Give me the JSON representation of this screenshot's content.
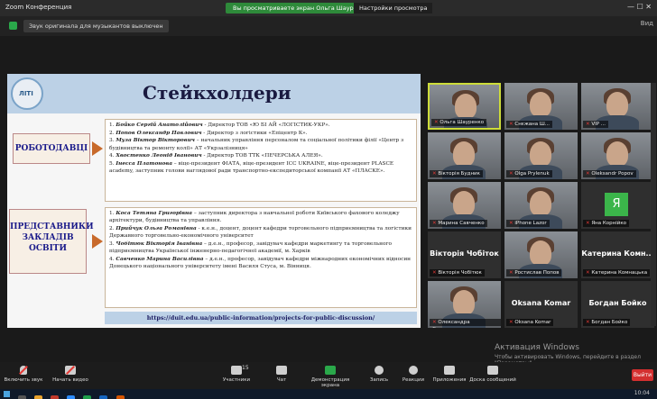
{
  "titlebar": {
    "app_title": "Zoom Конференция",
    "share_notice": "Вы просматриваете экран Ольга Шауренко",
    "view_options": "Настройки просмотра",
    "controls": "— ☐ ✕"
  },
  "notice": {
    "text": "Звук оригинала для музыкантов выключен",
    "right_label": "Вид"
  },
  "slide": {
    "logo_text": "ЛІТІ",
    "title": "Стейкхолдери",
    "label_employers": "РОБОТОДАВЦІ",
    "label_edu_lines": [
      "ПРЕДСТАВНИКИ",
      "ЗАКЛАДІВ",
      "ОСВІТИ"
    ],
    "employers": [
      {
        "n": "1.",
        "name": "Бойко Сергій Анатолійович",
        "text": " - Директор ТОВ «Ю БІ АЙ «ЛОГІСТИК-УКР»."
      },
      {
        "n": "2.",
        "name": "Попов Олександр Павлович",
        "text": " - Директор з логістики «Епіцентр К»."
      },
      {
        "n": "3.",
        "name": "Муза Віктор Вікторович",
        "text": " – начальник управління персоналом та соціальної політики філії «Центр з будівництва та ремонту колії» АТ «Укрзалізниця»"
      },
      {
        "n": "4.",
        "name": "Хвостенко Леонід Іванович",
        "text": " - Директор ТОВ ТТК «ПЕЧЕРСЬКА АЛЕЯ»."
      },
      {
        "n": "5.",
        "name": "Інесса Платонова",
        "text": " – віце-президент ФІАТА, віце-президент ICC UKRAINE, віце-президент PLASCE academy, заступник голови наглядової ради транспортно-експедиторської компанії АТ «ПЛАСКЕ»."
      }
    ],
    "edu": [
      {
        "n": "1.",
        "name": "Коса Тетяна Григорівна",
        "text": " – заступник директора з навчальної роботи Київського фахового коледжу архітектури, будівництва та управління."
      },
      {
        "n": "2.",
        "name": "Прийчук Ольга Романівна",
        "text": " - к.е.н., доцент, доцент кафедри торговельного підприємництва та логістики Державного торговельно-економічного університет"
      },
      {
        "n": "3.",
        "name": "Чобітюк Вікторія Іванівна",
        "text": " – д.е.н., професор, завідувач кафедри маркетингу та торговельного підприємництва Української інженерно-педагогічної академії, м. Харків"
      },
      {
        "n": "4.",
        "name": "Савченко Марина Василівна",
        "text": " – д.е.н., професор, завідувач кафедри міжнародних економічних відносин Донецького національного університету імені Василя Стуса, м. Вінниця."
      }
    ],
    "url": "https://duit.edu.ua/public-information/projects-for-public-discussion/"
  },
  "participants": [
    {
      "name": "Ольга Шауренко",
      "kind": "video"
    },
    {
      "name": "Снєжана Ш...",
      "kind": "video"
    },
    {
      "name": "VIP ...",
      "kind": "video"
    },
    {
      "name": "Вікторія Будник",
      "kind": "video"
    },
    {
      "name": "Olga Prylenuk",
      "kind": "video"
    },
    {
      "name": "Oleksandr Popov",
      "kind": "video"
    },
    {
      "name": "Марина Савченко",
      "kind": "video"
    },
    {
      "name": "iPhone Lazor",
      "kind": "video"
    },
    {
      "name": "Яна Корнійко",
      "kind": "avatar",
      "avatar_letter": "Я"
    },
    {
      "name": "Вікторія Чобітюк",
      "kind": "name",
      "label": "Вікторія Чобіток"
    },
    {
      "name": "Ростислав Попов",
      "kind": "video"
    },
    {
      "name": "Катерина Комнацька",
      "kind": "name",
      "label": "Катерина Комн..."
    },
    {
      "name": "Олександра Скоровська",
      "kind": "video"
    },
    {
      "name": "Oksana Komar",
      "kind": "name",
      "label": "Oksana Komar"
    },
    {
      "name": "Богдан Бойко",
      "kind": "name",
      "label": "Богдан Бойко"
    }
  ],
  "watermark": {
    "line1": "Активация Windows",
    "line2": "Чтобы активировать Windows, перейдите в раздел \"Параметры\"."
  },
  "toolbar": {
    "mic_label": "Включить звук",
    "video_label": "Начать видео",
    "participants_label": "Участники",
    "participants_count": "15",
    "chat_label": "Чат",
    "share_label": "Демонстрация экрана",
    "record_label": "Запись",
    "reactions_label": "Реакции",
    "apps_label": "Приложения",
    "whiteboard_label": "Доска сообщений",
    "end_label": "Выйти"
  },
  "taskbar": {
    "time": "10:04",
    "date": "2021"
  }
}
